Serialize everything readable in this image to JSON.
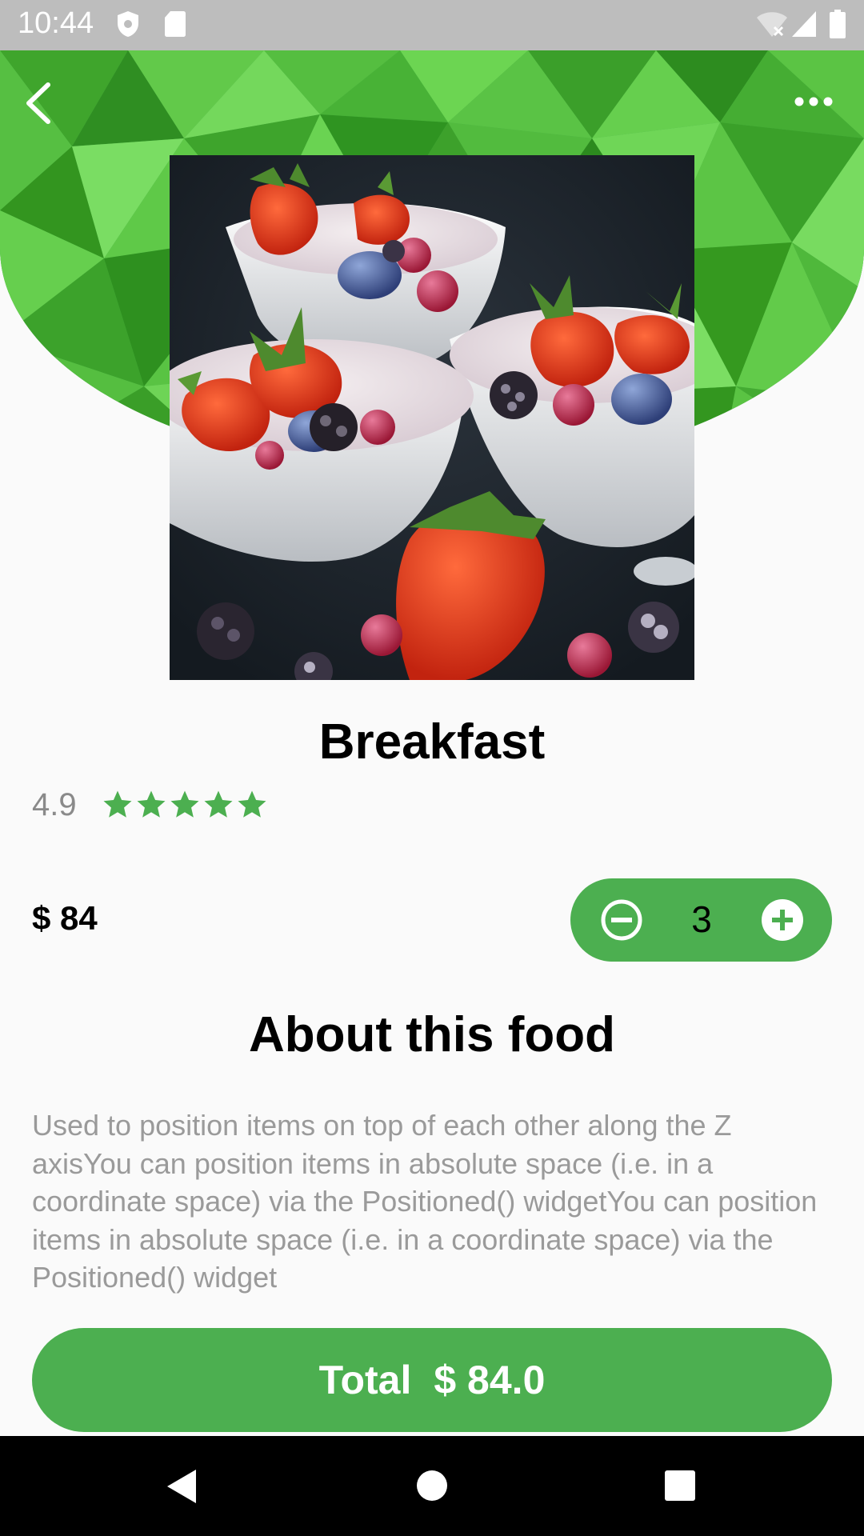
{
  "status_bar": {
    "time": "10:44"
  },
  "food": {
    "title": "Breakfast",
    "rating": "4.9",
    "stars": 5,
    "price": "$ 84",
    "quantity": "3"
  },
  "about": {
    "title": "About this food",
    "body": "Used to position items on top of each other along the Z axisYou can position items in absolute space (i.e. in a coordinate space) via the Positioned() widgetYou can position items in absolute space (i.e. in a coordinate space) via the Positioned() widget"
  },
  "total": {
    "label": "Total",
    "value": "$ 84.0"
  },
  "colors": {
    "accent": "#4CAF50",
    "header_light": "#6FD45A",
    "header_dark": "#2E8B1E",
    "status_bar": "#BDBDBD"
  },
  "icons": {
    "back": "arrow-back-icon",
    "more": "more-horiz-icon",
    "minus": "remove-circle-icon",
    "plus": "add-circle-icon",
    "star": "star-icon"
  }
}
